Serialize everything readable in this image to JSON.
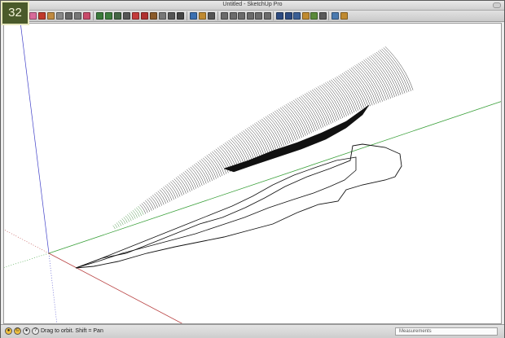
{
  "badge": {
    "number": "32"
  },
  "window": {
    "title": "Untitled - SketchUp Pro"
  },
  "toolbar": {
    "buttons": [
      {
        "icon": "select-arrow-icon",
        "color": "#2f6fb8"
      },
      {
        "icon": "eraser-icon",
        "color": "#d86a9a"
      },
      {
        "icon": "pencil-icon",
        "color": "#c0392b"
      },
      {
        "icon": "rectangle-icon",
        "color": "#c08a40"
      },
      {
        "icon": "circle-icon",
        "color": "#888888"
      },
      {
        "icon": "arc-icon",
        "color": "#666666"
      },
      {
        "icon": "polygon-icon",
        "color": "#777777"
      },
      {
        "icon": "paint-bucket-icon",
        "color": "#c94a6a"
      },
      {
        "icon": "move-icon",
        "color": "#3a7a3a"
      },
      {
        "icon": "pushpull-icon",
        "color": "#3d7d3d"
      },
      {
        "icon": "rotate-icon",
        "color": "#446644"
      },
      {
        "icon": "followme-icon",
        "color": "#555555"
      },
      {
        "icon": "scale-icon",
        "color": "#c43a3a"
      },
      {
        "icon": "offset-icon",
        "color": "#b03030"
      },
      {
        "icon": "tape-measure-icon",
        "color": "#8a5a2a"
      },
      {
        "icon": "dimension-icon",
        "color": "#777777"
      },
      {
        "icon": "protractor-icon",
        "color": "#555555"
      },
      {
        "icon": "text-icon",
        "color": "#444444"
      },
      {
        "icon": "orbit-icon",
        "color": "#3a6fb0"
      },
      {
        "icon": "pan-icon",
        "color": "#c08a30"
      },
      {
        "icon": "zoom-icon",
        "color": "#555555"
      },
      {
        "icon": "standard-view-iso-icon",
        "color": "#6b6b6b"
      },
      {
        "icon": "standard-view-top-icon",
        "color": "#6b6b6b"
      },
      {
        "icon": "standard-view-front-icon",
        "color": "#6b6b6b"
      },
      {
        "icon": "standard-view-right-icon",
        "color": "#6b6b6b"
      },
      {
        "icon": "standard-view-back-icon",
        "color": "#6b6b6b"
      },
      {
        "icon": "standard-view-left-icon",
        "color": "#6b6b6b"
      },
      {
        "icon": "style-xray-icon",
        "color": "#2c4a80"
      },
      {
        "icon": "style-wireframe-icon",
        "color": "#2c4a80"
      },
      {
        "icon": "style-hidden-line-icon",
        "color": "#3b5f95"
      },
      {
        "icon": "style-shaded-icon",
        "color": "#c08a30"
      },
      {
        "icon": "style-textured-icon",
        "color": "#5a8a3a"
      },
      {
        "icon": "style-monochrome-icon",
        "color": "#5a5a5a"
      },
      {
        "icon": "warehouse-icon",
        "color": "#4a7ab0"
      },
      {
        "icon": "components-icon",
        "color": "#c08a30"
      }
    ]
  },
  "viewport": {
    "axis_colors": {
      "red": "#b84040",
      "green": "#3aa03a",
      "blue": "#4040c8"
    }
  },
  "status": {
    "hint": "Drag to orbit.  Shift = Pan",
    "measurements_label": "Measurements"
  }
}
